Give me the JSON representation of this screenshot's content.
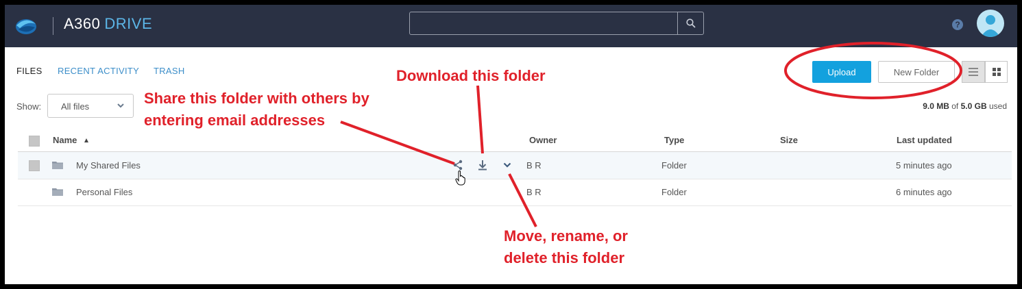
{
  "header": {
    "brand_primary": "A360",
    "brand_secondary": "DRIVE",
    "help_label": "?"
  },
  "tabs": [
    {
      "label": "FILES"
    },
    {
      "label": "RECENT ACTIVITY"
    },
    {
      "label": "TRASH"
    }
  ],
  "filter": {
    "label": "Show:",
    "selected": "All files"
  },
  "toolbar": {
    "upload_label": "Upload",
    "new_folder_label": "New Folder"
  },
  "usage": {
    "used": "9.0 MB",
    "of": "of",
    "total": "5.0 GB",
    "suffix": "used"
  },
  "table": {
    "columns": {
      "name": "Name",
      "owner": "Owner",
      "type": "Type",
      "size": "Size",
      "updated": "Last updated"
    },
    "rows": [
      {
        "name": "My Shared Files",
        "owner": "B R",
        "type": "Folder",
        "size": "",
        "updated": "5 minutes ago"
      },
      {
        "name": "Personal Files",
        "owner": "B R",
        "type": "Folder",
        "size": "",
        "updated": "6 minutes ago"
      }
    ]
  },
  "annotations": {
    "download": "Download this folder",
    "share_line1": "Share this folder with others by",
    "share_line2": "entering email addresses",
    "move_line1": "Move, rename, or",
    "move_line2": "delete this folder"
  },
  "colors": {
    "topbar": "#2a3144",
    "accent": "#13a1de",
    "annotation": "#e0212a"
  }
}
